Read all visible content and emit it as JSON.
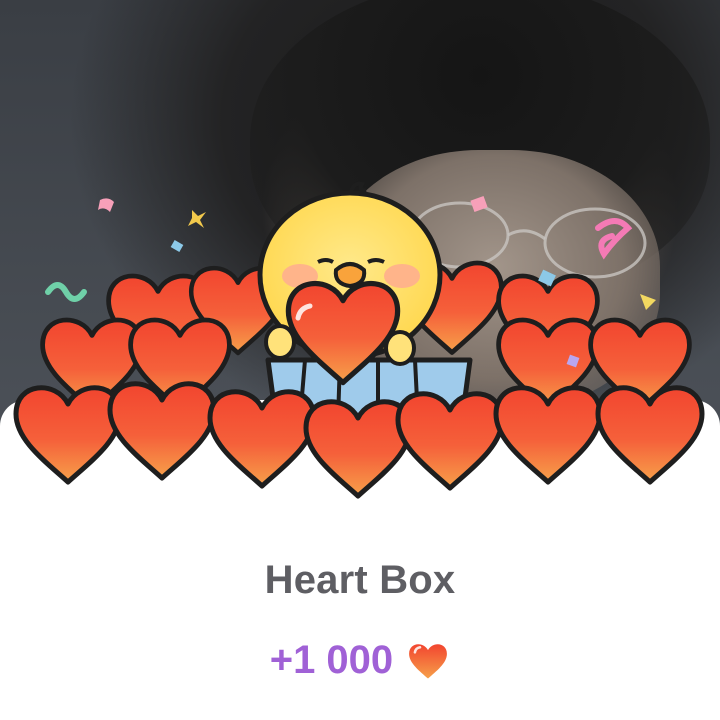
{
  "popup": {
    "title": "Heart Box",
    "reward_amount": "+1 000"
  },
  "icons": {
    "reward_icon": "heart-icon",
    "mascot": "yellow-chick-mascot"
  },
  "colors": {
    "title": "#5e5e63",
    "reward": "#a061d6",
    "heart": "#f4553a"
  }
}
